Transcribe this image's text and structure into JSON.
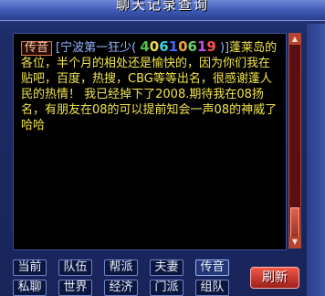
{
  "window": {
    "title": "聊天记录查询"
  },
  "message": {
    "tag": "传音",
    "sender_prefix": "[宁波第一狂少(",
    "sender_id_digits": [
      "4",
      "0",
      "6",
      "1",
      "0",
      "6",
      "1",
      "9"
    ],
    "sender_id_colors": [
      "#49c34a",
      "#f0d94a",
      "#3ad0e8",
      "#3b6bff",
      "#f0a43a",
      "#6fd06f",
      "#c64be0",
      "#ff5050"
    ],
    "sender_suffix": ")]",
    "text": "蓬莱岛的各位，半个月的相处还是愉快的，因为你们我在贴吧，百度，热搜，CBG等等出名，很感谢蓬人民的热情！ 我已经掉下了2008.期待我在08扬名，有朋友在08的可以提前知会一声08的神威了 哈哈"
  },
  "tabs": [
    "当前",
    "队伍",
    "帮派",
    "夫妻",
    "传音",
    "私聊",
    "世界",
    "经济",
    "门派",
    "组队"
  ],
  "refresh_label": "刷新",
  "colors": {
    "message_text": "#f3e64b",
    "accent": "#d63a2e"
  }
}
